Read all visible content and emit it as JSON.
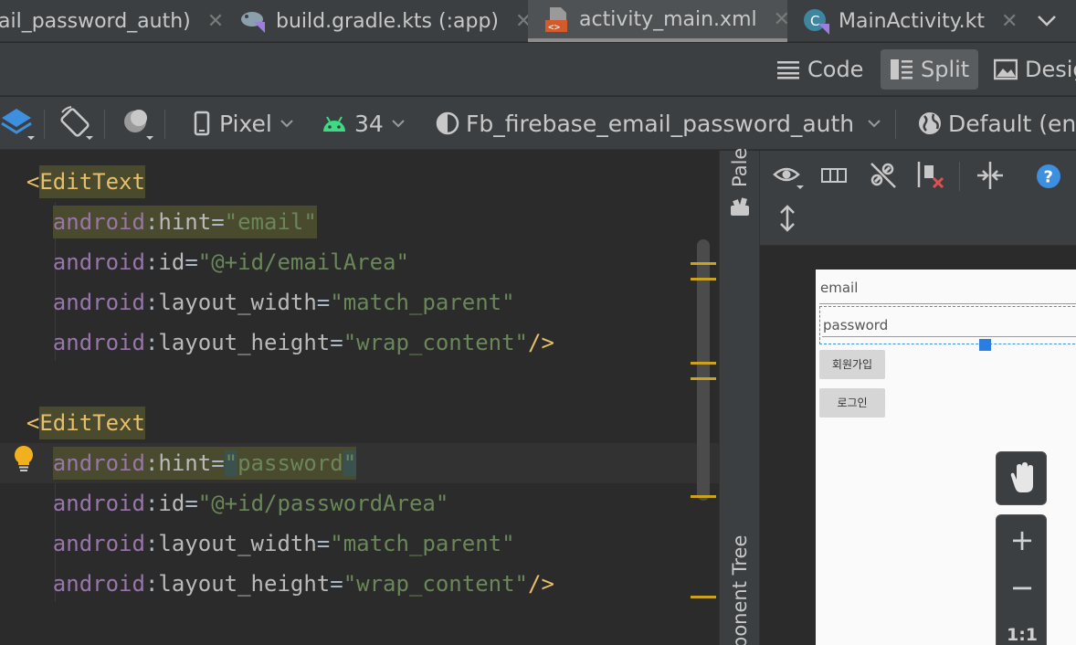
{
  "tabs": [
    {
      "label": "ail_password_auth)",
      "active": false
    },
    {
      "label": "build.gradle.kts (:app)",
      "active": false
    },
    {
      "label": "activity_main.xml",
      "active": true
    },
    {
      "label": "MainActivity.kt",
      "active": false
    }
  ],
  "view_modes": {
    "code": "Code",
    "split": "Split",
    "design": "Desig",
    "selected": "Split"
  },
  "toolbar": {
    "device": "Pixel",
    "api": "34",
    "theme": "Fb_firebase_email_password_auth",
    "locale": "Default (en-"
  },
  "side_panels": {
    "palette": "Pale",
    "component_tree": "ponent Tree"
  },
  "code": {
    "line1": {
      "open": "<",
      "tag": "EditText"
    },
    "line2": {
      "ns": "android",
      "colon": ":",
      "attr": "hint",
      "eq": "=",
      "value": "\"email\""
    },
    "line3": {
      "ns": "android",
      "colon": ":",
      "attr": "id",
      "eq": "=",
      "value": "\"@+id/emailArea\""
    },
    "line4": {
      "ns": "android",
      "colon": ":",
      "attr": "layout_width",
      "eq": "=",
      "value": "\"match_parent\""
    },
    "line5": {
      "ns": "android",
      "colon": ":",
      "attr": "layout_height",
      "eq": "=",
      "value": "\"wrap_content\"",
      "close": "/>"
    },
    "line6": {
      "open": "<",
      "tag": "EditText"
    },
    "line7": {
      "ns": "android",
      "colon": ":",
      "attr": "hint",
      "eq": "=",
      "q1": "\"",
      "value": "password",
      "q2": "\""
    },
    "line8": {
      "ns": "android",
      "colon": ":",
      "attr": "id",
      "eq": "=",
      "value": "\"@+id/passwordArea\""
    },
    "line9": {
      "ns": "android",
      "colon": ":",
      "attr": "layout_width",
      "eq": "=",
      "value": "\"match_parent\""
    },
    "line10": {
      "ns": "android",
      "colon": ":",
      "attr": "layout_height",
      "eq": "=",
      "value": "\"wrap_content\"",
      "close": "/>"
    }
  },
  "preview": {
    "email_hint": "email",
    "password_hint": "password",
    "signup_button": "회원가입",
    "login_button": "로그인"
  },
  "zoom": {
    "plus": "+",
    "minus": "−",
    "reset": "1:1"
  },
  "colors": {
    "accent_blue": "#2a7de1",
    "tag_yellow": "#e8bf6a",
    "attr_purple": "#9876aa",
    "string_green": "#6a8759"
  },
  "icons": [
    "layers-icon",
    "rotate-icon",
    "night-mode-icon",
    "device-icon",
    "android-icon",
    "theme-icon",
    "globe-icon",
    "eye-icon",
    "blueprint-icon",
    "constraint-off-icon",
    "clear-constraints-icon",
    "guidelines-icon",
    "help-icon",
    "vertical-resize-icon",
    "pan-hand-icon",
    "lightbulb-icon"
  ]
}
